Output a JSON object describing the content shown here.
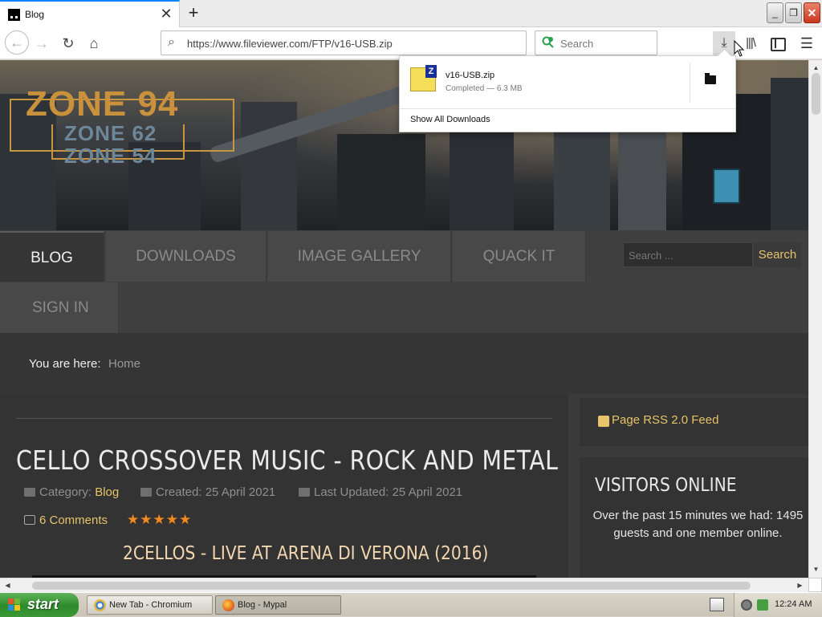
{
  "browser": {
    "tab_title": "Blog",
    "tab_close_icon": "close-icon",
    "new_tab_icon": "plus-icon",
    "url": "https://www.fileviewer.com/FTP/v16-USB.zip",
    "search_placeholder": "Search"
  },
  "downloads_popup": {
    "file_name": "v16-USB.zip",
    "status": "Completed — 6.3 MB",
    "show_all": "Show All Downloads"
  },
  "site": {
    "logo_main": "ZONE 94",
    "logo_sub1": "ZONE 62",
    "logo_sub2": "ZONE 54",
    "nav": {
      "blog": "BLOG",
      "downloads": "DOWNLOADS",
      "gallery": "IMAGE GALLERY",
      "quack": "QUACK IT",
      "signin": "SIGN IN"
    },
    "search_placeholder": "Search ...",
    "search_button": "Search"
  },
  "breadcrumb": {
    "label": "You are here:",
    "home": "Home"
  },
  "article": {
    "title": "CELLO CROSSOVER MUSIC - ROCK AND METAL",
    "category_label": "Category:",
    "category_value": "Blog",
    "created": "Created: 25 April 2021",
    "updated": "Last Updated: 25 April 2021",
    "comments": "6 Comments",
    "rating_stars": "★★★★★",
    "rating": 5,
    "subtitle": "2CELLOS - LIVE AT ARENA DI VERONA (2016)"
  },
  "sidebar": {
    "rss": "Page RSS 2.0 Feed",
    "visitors_title": "VISITORS ONLINE",
    "visitors_text": "Over the past 15 minutes we had: 1495 guests and one member online."
  },
  "taskbar": {
    "start": "start",
    "task1": "New Tab - Chromium",
    "task2": "Blog - Mypal",
    "clock": "12:24 AM"
  },
  "colors": {
    "accent_gold": "#e7c36a",
    "star_orange": "#f28a1d",
    "firefox_blue": "#0a84ff"
  }
}
